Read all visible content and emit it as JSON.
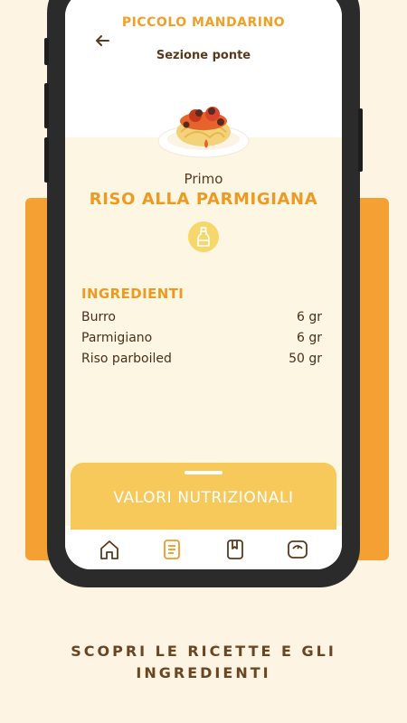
{
  "header": {
    "back_icon": "arrow-left-icon",
    "title": "PICCOLO MANDARINO",
    "subtitle": "Sezione ponte"
  },
  "recipe": {
    "course": "Primo",
    "name": "RISO ALLA PARMIGIANA",
    "badge_icon": "bottle-icon",
    "dish_image": "pasta-plate-illustration"
  },
  "ingredients": {
    "title": "INGREDIENTI",
    "items": [
      {
        "name": "Burro",
        "qty": "6 gr"
      },
      {
        "name": "Parmigiano",
        "qty": "6 gr"
      },
      {
        "name": "Riso parboiled",
        "qty": "50 gr"
      }
    ]
  },
  "sheet": {
    "label": "VALORI NUTRIZIONALI"
  },
  "navbar": {
    "items": [
      {
        "icon": "home-icon"
      },
      {
        "icon": "document-icon"
      },
      {
        "icon": "bookmark-book-icon"
      },
      {
        "icon": "scale-icon"
      }
    ]
  },
  "caption": "SCOPRI LE RICETTE E GLI INGREDIENTI",
  "colors": {
    "accent": "#ee9a22",
    "background": "#fdf4e3",
    "band": "#f5a033",
    "sheet": "#f7c85a"
  }
}
